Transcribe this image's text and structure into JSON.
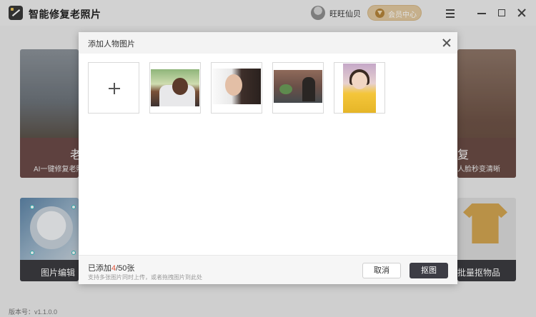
{
  "app": {
    "title": "智能修复老照片",
    "user_name": "旺旺仙贝",
    "vip_label": "会员中心",
    "version": "版本号：v1.1.0.0"
  },
  "cards": {
    "left_top": {
      "title": "老",
      "subtitle": "AI一键修复老照"
    },
    "right_top": {
      "title": "复",
      "subtitle": "人脸秒变清晰"
    },
    "left_bottom": {
      "title": "图片编辑"
    },
    "right_bottom": {
      "title": "批量抠物品"
    }
  },
  "modal": {
    "title": "添加人物图片",
    "added_prefix": "已添加",
    "added_count": "4",
    "added_total": "/50张",
    "hint": "支持多张图片同时上传，或者拖拽图片到此处",
    "cancel_label": "取消",
    "confirm_label": "抠图"
  },
  "colors": {
    "accent": "#e0533a",
    "primary_button": "#3d3d45",
    "vip": "#e2c9a0"
  },
  "icons": [
    "app-logo-icon",
    "menu-icon",
    "minimize-icon",
    "maximize-icon",
    "close-icon",
    "plus-icon",
    "vip-diamond-icon"
  ]
}
